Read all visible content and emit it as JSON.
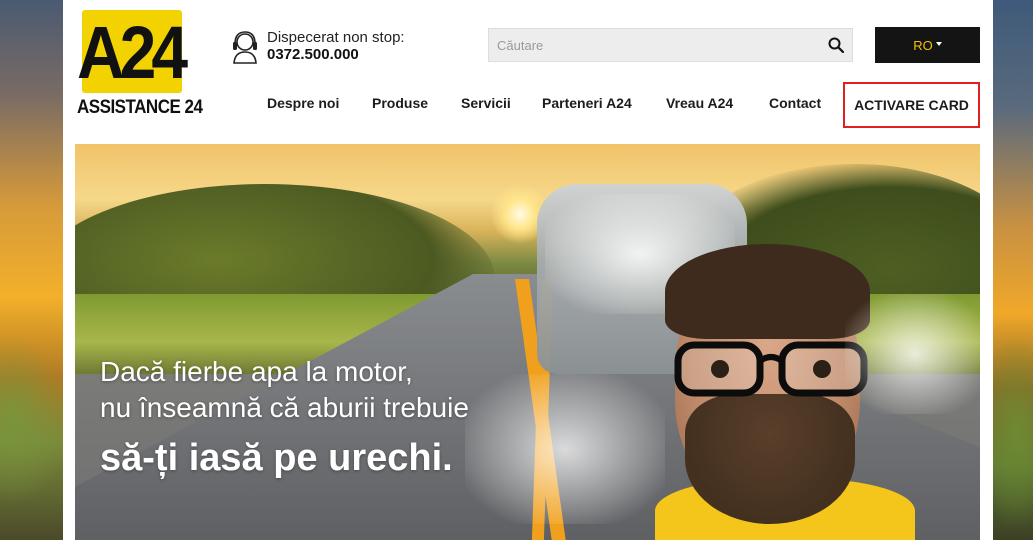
{
  "logo": {
    "mark": "A24",
    "subtitle": "ASSISTANCE 24"
  },
  "dispatch": {
    "label": "Dispecerat non stop:",
    "phone": "0372.500.000"
  },
  "search": {
    "placeholder": "Căutare"
  },
  "language": {
    "selected": "RO"
  },
  "nav": {
    "items": [
      {
        "label": "Despre noi"
      },
      {
        "label": "Produse"
      },
      {
        "label": "Servicii"
      },
      {
        "label": "Parteneri A24"
      },
      {
        "label": "Vreau A24"
      },
      {
        "label": "Contact"
      }
    ],
    "cta": "ACTIVARE CARD"
  },
  "hero": {
    "line1": "Dacă fierbe apa la motor,",
    "line2": "nu înseamnă că aburii trebuie",
    "line3": "să-ți iasă pe urechi."
  },
  "colors": {
    "brand_yellow": "#f2d200",
    "cta_border": "#e02020",
    "lang_bg": "#141414",
    "lang_text": "#f2c400"
  },
  "icons": [
    "headset-icon",
    "search-icon",
    "caret-down-icon"
  ]
}
